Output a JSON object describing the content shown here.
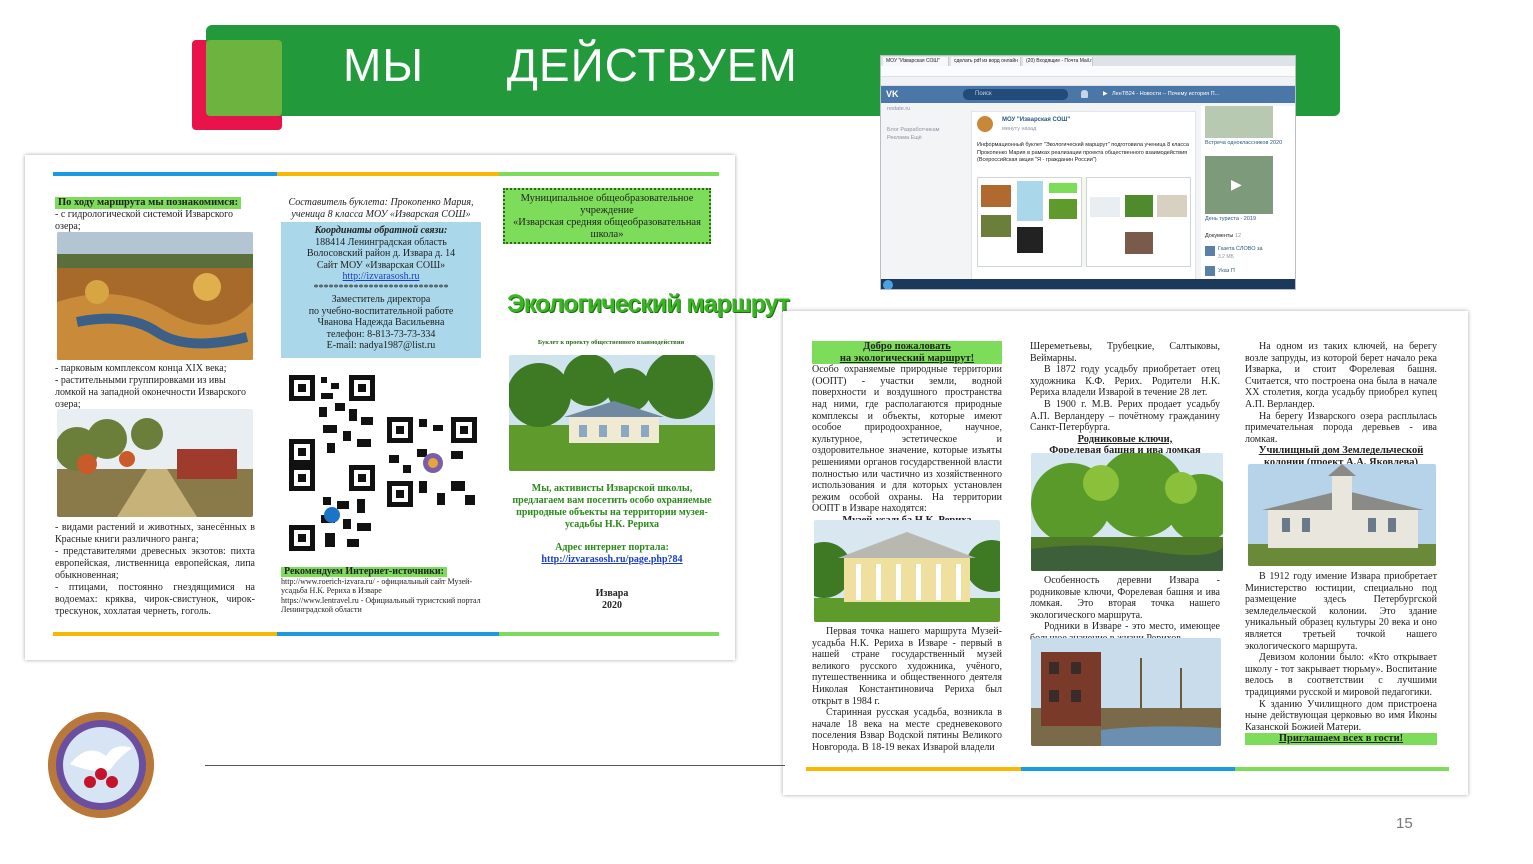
{
  "slide": {
    "title_word1": "МЫ",
    "title_word2": "ДЕЙСТВУЕМ",
    "page_number": "15",
    "colors": {
      "banner": "#229a3c",
      "accent_red": "#e8134a",
      "accent_green": "#6cb33f",
      "highlight": "#7ddc5a"
    }
  },
  "booklet1": {
    "col1": {
      "heading": "По ходу маршрута мы познакомимся:",
      "item1": "- с гидрологической системой Изварского озера;",
      "item2": "- парковым комплексом конца XIX века;\n- растительными группировками из ивы ломкой на западной оконечности Изварского озера;",
      "item3": "- видами растений и животных, занесённых в Красные книги различного ранга;\n- представителями древесных экзотов: пихта европейская, лиственница европейская, липа обыкновенная;\n- птицами, постоянно гнездящимися на водоемах: кряква, чирок-свистунок, чирок-трескунок, хохлатая чернеть, гоголь."
    },
    "col2": {
      "compiler": "Составитель буклета: Прокопенко Мария, ученица 8 класса МОУ «Изварская СОШ»",
      "feedback_title": "Координаты обратной связи:",
      "address": "188414 Ленинградская область\nВолосовский район д. Извара д. 14\nСайт МОУ «Изварская СОШ»",
      "site_link": "http://izvarasosh.ru",
      "stars": "***************************",
      "deputy": "Заместитель директора\nпо учебно-воспитательной работе\nЧванова Надежда Васильевна\nтелефон: 8-813-73-73-334\nE-mail: nadya1987@list.ru",
      "sources_heading": "Рекомендуем Интернет-источники:",
      "sources": "http://www.roerich-izvara.ru/ - официальный сайт Музей-усадьба Н.К. Рериха в Изваре\nhttps://www.lentravel.ru - Официальный туристский портал Ленинградской области"
    },
    "col3": {
      "school_box": "Муниципальное общеобразовательное учреждение\n«Изварская средняя общеобразовательная школа»",
      "title": "Экологический маршрут",
      "subtitle": "Буклет к проекту общественного взаимодействия",
      "invite": "Мы, активисты Изварской школы, предлагаем вам посетить особо охраняемые природные объекты на территории музея-усадьбы Н.К. Рериха",
      "portal_label": "Адрес интернет портала:",
      "portal_link": "http://izvarasosh.ru/page.php?84",
      "place": "Извара",
      "year": "2020"
    }
  },
  "screenshot": {
    "tabs": [
      "МОУ \"Изварская СОШ\"",
      "сделать pdf из ворд онлайн",
      "(20) Входящие - Почта Mail.ru"
    ],
    "search_placeholder": "Поиск",
    "news_ticker": "ЛенТВ24 - Новости -- Почему история П...",
    "sidebar_brand": "restate.ru",
    "sidebar_links": "Блог Разработчикам\nРеклама Ещё",
    "post_author": "МОУ \"Изварская СОШ\"",
    "post_time": "минуту назад",
    "post_text": "Информационный буклет \"Экологический маршрут\" подготовила ученица 8 класса Прокопенко Мария в рамках реализации проекта общественного взаимодействия (Всероссийская акция \"Я - гражданин России\")",
    "right_caption1": "Встреча одноклассников 2020",
    "right_caption2": "День туриста - 2019",
    "docs_label": "Документы",
    "docs_count": "12",
    "doc1": "Газета СЛОВО за",
    "doc1_size": "3.2 МБ",
    "doc2": "Указ П"
  },
  "booklet2": {
    "col1": {
      "welcome": "Добро пожаловать\nна экологический маршрут!",
      "oopt": "Особо охраняемые природные территории (ООПТ) - участки земли, водной поверхности и воздушного пространства над ними, где располагаются природные комплексы и объекты, которые имеют особое природоохранное, научное, культурное, эстетическое и оздоровительное значение, которые изъяты решениями органов государственной власти полностью или частично из хозяйственного использования и для которых установлен режим особой охраны. На территории ООПТ в Изваре находятся:",
      "museum_heading": "Музей-усадьба Н.К. Рериха",
      "museum_text": "Первая точка нашего маршрута Музей-усадьба Н.К. Рериха в Изваре - первый в нашей стране государственный музей великого русского художника, учёного, путешественника и общественного деятеля Николая Константиновича Рериха был открыт в 1984 г.",
      "estate_text": "Старинная русская усадьба, возникла в начале 18 века на месте средневекового поселения Взвар Водской пятины Великого Новгорода. В 18-19 веках Изварой владели"
    },
    "col2": {
      "owners": "Шереметьевы, Трубецкие, Салтыковы, Веймарны.",
      "p1872": "В 1872 году усадьбу приобретает отец художника К.Ф. Рерих. Родители Н.К. Рериха владели Изварой в течение 28 лет.",
      "p1900": "В 1900 г. М.В. Рерих продает усадьбу А.П. Верландеру – почётному гражданину Санкт-Петербурга.",
      "springs_heading": "Родниковые ключи,\nФорелевая башня и ива ломкая",
      "springs_text": "Особенность деревни Извара - родниковые ключи, Форелевая башня и ива ломкая. Это вторая точка нашего экологического маршрута.",
      "springs_text2": "Родники в Изваре - это место, имеющее большое значение в жизни Рерихов."
    },
    "col3": {
      "intro": "На одном из таких ключей, на берегу возле запруды, из которой берет начало река Изварка, и стоит Форелевая башня. Считается, что построена она была в начале XX столетия, когда усадьбу приобрел купец А.П. Верландер.",
      "willow": "На берегу Изварского озера расплылась примечательная порода деревьев - ива ломкая.",
      "school_heading": "Училищный дом Земледельческой колонии (проект А.А. Яковлева)",
      "p1912": "В 1912 году имение Извара приобретает Министерство юстиции, специально под размещение здесь Петербургской земледельческой колонии. Это здание уникальный образец культуры 20 века и оно является третьей точкой нашего экологического маршрута.",
      "motto": "Девизом колонии было: «Кто открывает школу - тот закрывает тюрьму». Воспитание велось в соответствии с лучшими традициями русской и мировой педагогики.",
      "church": "К зданию Училищного дом пристроена ныне действующая церковью во имя Иконы Казанской Божией Матери.",
      "invite": "Приглашаем всех в гости!"
    }
  }
}
